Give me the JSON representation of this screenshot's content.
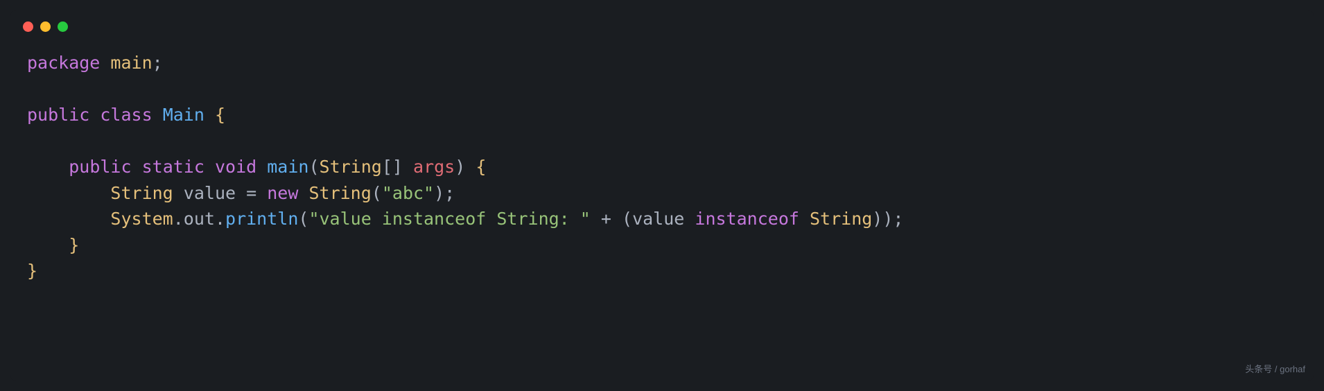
{
  "code": {
    "line1": {
      "package": "package",
      "pkgname": "main",
      "semi": ";"
    },
    "line3": {
      "public": "public",
      "class": "class",
      "classname": "Main",
      "brace": "{"
    },
    "line5": {
      "public": "public",
      "static": "static",
      "void": "void",
      "main": "main",
      "lparen": "(",
      "string": "String",
      "brackets": "[]",
      "args": "args",
      "rparen": ")",
      "brace": "{"
    },
    "line6": {
      "string": "String",
      "value": "value",
      "eq": "=",
      "new": "new",
      "stringctor": "String",
      "lparen": "(",
      "literal": "\"abc\"",
      "rparen": ")",
      "semi": ";"
    },
    "line7": {
      "system": "System",
      "dot1": ".",
      "out": "out",
      "dot2": ".",
      "println": "println",
      "lparen": "(",
      "literal": "\"value instanceof String: \"",
      "plus": "+",
      "lparen2": "(",
      "value": "value",
      "instanceof": "instanceof",
      "string": "String",
      "rparen2": ")",
      "rparen": ")",
      "semi": ";"
    },
    "line8": {
      "brace": "}"
    },
    "line9": {
      "brace": "}"
    }
  },
  "watermark": "头条号 / gorhaf"
}
